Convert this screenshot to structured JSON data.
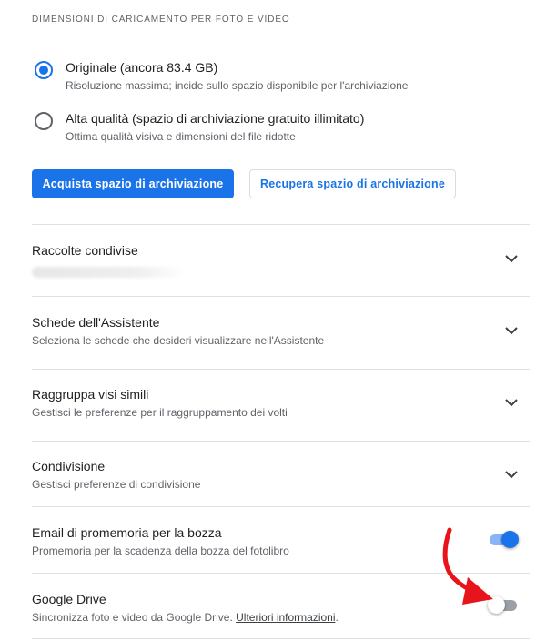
{
  "section": {
    "label": "DIMENSIONI DI CARICAMENTO PER FOTO E VIDEO"
  },
  "upload_options": [
    {
      "title": "Originale (ancora 83.4 GB)",
      "subtitle": "Risoluzione massima; incide sullo spazio disponibile per l'archiviazione",
      "selected": true
    },
    {
      "title": "Alta qualità (spazio di archiviazione gratuito illimitato)",
      "subtitle": "Ottima qualità visiva e dimensioni del file ridotte",
      "selected": false
    }
  ],
  "buttons": {
    "buy_storage": "Acquista spazio di archiviazione",
    "recover_storage": "Recupera spazio di archiviazione"
  },
  "settings": [
    {
      "title": "Raccolte condivise",
      "subtitle": "",
      "control": "chevron-down-icon"
    },
    {
      "title": "Schede dell'Assistente",
      "subtitle": "Seleziona le schede che desideri visualizzare nell'Assistente",
      "control": "chevron-down-icon"
    },
    {
      "title": "Raggruppa visi simili",
      "subtitle": "Gestisci le preferenze per il raggruppamento dei volti",
      "control": "chevron-down-icon"
    },
    {
      "title": "Condivisione",
      "subtitle": "Gestisci preferenze di condivisione",
      "control": "chevron-down-icon"
    },
    {
      "title": "Email di promemoria per la bozza",
      "subtitle": "Promemoria per la scadenza della bozza del fotolibro",
      "control": "toggle",
      "toggle_on": true
    },
    {
      "title": "Google Drive",
      "subtitle": "Sincronizza foto e video da Google Drive.",
      "link": "Ulteriori informazioni",
      "subtitle_end": ".",
      "control": "toggle",
      "toggle_on": false
    }
  ],
  "colors": {
    "accent": "#1a73e8",
    "annotation": "#e8141b"
  },
  "icons": {
    "annotation": "red-arrow-icon"
  }
}
